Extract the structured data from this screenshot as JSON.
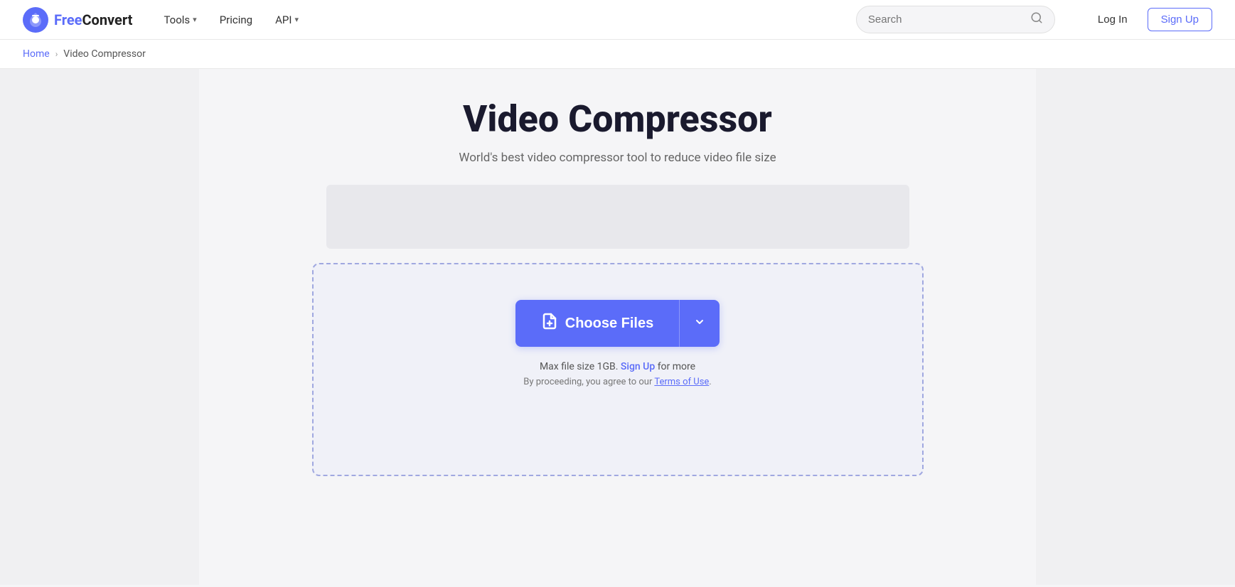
{
  "brand": {
    "name_free": "Free",
    "name_convert": "Convert",
    "logo_alt": "FreeConvert logo"
  },
  "navbar": {
    "tools_label": "Tools",
    "pricing_label": "Pricing",
    "api_label": "API",
    "search_placeholder": "Search",
    "login_label": "Log In",
    "signup_label": "Sign Up"
  },
  "breadcrumb": {
    "home_label": "Home",
    "separator": "›",
    "current_label": "Video Compressor"
  },
  "page": {
    "title": "Video Compressor",
    "subtitle": "World's best video compressor tool to reduce video file size"
  },
  "upload": {
    "choose_files_label": "Choose Files",
    "dropdown_icon": "⌄",
    "file_icon": "📄",
    "max_size_text": "Max file size 1GB.",
    "signup_link_label": "Sign Up",
    "signup_link_suffix": " for more",
    "terms_prefix": "By proceeding, you agree to our ",
    "terms_link_label": "Terms of Use",
    "terms_suffix": "."
  }
}
